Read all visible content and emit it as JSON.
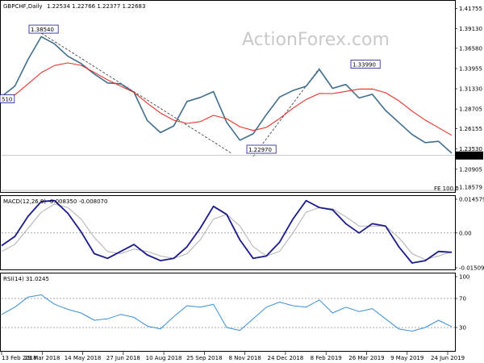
{
  "header": {
    "title": "GBPCHF,Daily",
    "ohlc": "1.22534 1.22766 1.22377 1.22683",
    "watermark": "ActionForex.com"
  },
  "colors": {
    "price": "#3f6e8c",
    "sma": "#e8322a",
    "macd": "#1a1a8c",
    "signal": "#b0b0b0",
    "rsi": "#3a8fd6",
    "grid": "#909090"
  },
  "chart_data": [
    {
      "type": "line",
      "panel": "price",
      "ylim": [
        1.18579,
        1.42
      ],
      "yticks": [
        "1.41755",
        "1.39130",
        "1.36580",
        "1.33955",
        "1.31330",
        "1.28705",
        "1.26155",
        "1.23530",
        "1.20905",
        "1.18579"
      ],
      "last_price": "1.22683",
      "fe_label": "FE 100.0",
      "annotations": [
        {
          "label": "1.38540",
          "value": 1.3854
        },
        {
          "label": "1.33990",
          "value": 1.3399
        },
        {
          "label": "1.22970",
          "value": 1.2297
        },
        {
          "label": "510",
          "value": 1.2951
        }
      ],
      "x": [
        "13 Feb 2018",
        "29 Mar 2018",
        "14 May 2018",
        "27 Jun 2018",
        "10 Aug 2018",
        "25 Sep 2018",
        "8 Nov 2018",
        "24 Dec 2018",
        "8 Feb 2019",
        "26 Mar 2019",
        "9 May 2019",
        "24 Jun 2019"
      ],
      "series": [
        {
          "key": "price",
          "values": [
            1.3033,
            1.3167,
            1.3514,
            1.3809,
            1.3715,
            1.3555,
            1.3461,
            1.3325,
            1.3209,
            1.3197,
            1.3087,
            1.2723,
            1.2565,
            1.2651,
            1.2968,
            1.3021,
            1.3096,
            1.2697,
            1.2466,
            1.2549,
            1.2798,
            1.3026,
            1.3111,
            1.3166,
            1.3384,
            1.3139,
            1.3189,
            1.3013,
            1.3061,
            1.2852,
            1.2696,
            1.2541,
            1.2435,
            1.2452,
            1.2298
          ]
        },
        {
          "key": "sma",
          "values": [
            1.2955,
            1.3053,
            1.3197,
            1.3343,
            1.3435,
            1.3468,
            1.3437,
            1.3346,
            1.3248,
            1.3168,
            1.3085,
            1.2947,
            1.2819,
            1.2726,
            1.2684,
            1.2707,
            1.2788,
            1.2746,
            1.2641,
            1.2593,
            1.2632,
            1.2748,
            1.2881,
            1.2994,
            1.3072,
            1.3071,
            1.3099,
            1.3129,
            1.313,
            1.3082,
            1.2978,
            1.2844,
            1.2727,
            1.2628,
            1.253
          ]
        }
      ]
    },
    {
      "type": "line",
      "panel": "macd",
      "title": "MACD(12,26,9) -0.008350 -0.008070",
      "ylim": [
        -0.015096,
        0.014579
      ],
      "yticks": [
        "0.014579",
        "0.00",
        "-0.015096"
      ],
      "series": [
        {
          "key": "macd",
          "values": [
            -0.0055,
            -0.0015,
            0.0072,
            0.0136,
            0.014,
            0.0085,
            0.0005,
            -0.009,
            -0.011,
            -0.008,
            -0.005,
            -0.0095,
            -0.012,
            -0.011,
            -0.006,
            0.002,
            0.0115,
            0.008,
            -0.003,
            -0.011,
            -0.01,
            -0.004,
            0.006,
            0.014,
            0.011,
            0.01,
            0.004,
            0.0,
            0.004,
            0.003,
            -0.006,
            -0.013,
            -0.012,
            -0.008,
            -0.0084
          ]
        },
        {
          "key": "signal",
          "values": [
            -0.008,
            -0.005,
            0.002,
            0.009,
            0.0125,
            0.011,
            0.006,
            -0.002,
            -0.008,
            -0.009,
            -0.007,
            -0.008,
            -0.01,
            -0.011,
            -0.009,
            -0.003,
            0.006,
            0.008,
            0.003,
            -0.006,
            -0.01,
            -0.008,
            0.0,
            0.009,
            0.011,
            0.0105,
            0.007,
            0.003,
            0.003,
            0.003,
            -0.002,
            -0.009,
            -0.0115,
            -0.01,
            -0.0081
          ]
        }
      ]
    },
    {
      "type": "line",
      "panel": "rsi",
      "title": "RSI(14) 31.0245",
      "ylim": [
        0,
        100
      ],
      "yticks": [
        "100",
        "70",
        "30",
        "0"
      ],
      "series": [
        {
          "key": "rsi",
          "values": [
            48,
            58,
            72,
            75,
            62,
            55,
            50,
            40,
            42,
            48,
            44,
            32,
            28,
            45,
            60,
            58,
            62,
            30,
            26,
            42,
            58,
            65,
            60,
            58,
            68,
            50,
            58,
            52,
            56,
            42,
            28,
            25,
            30,
            40,
            31
          ]
        }
      ]
    }
  ]
}
